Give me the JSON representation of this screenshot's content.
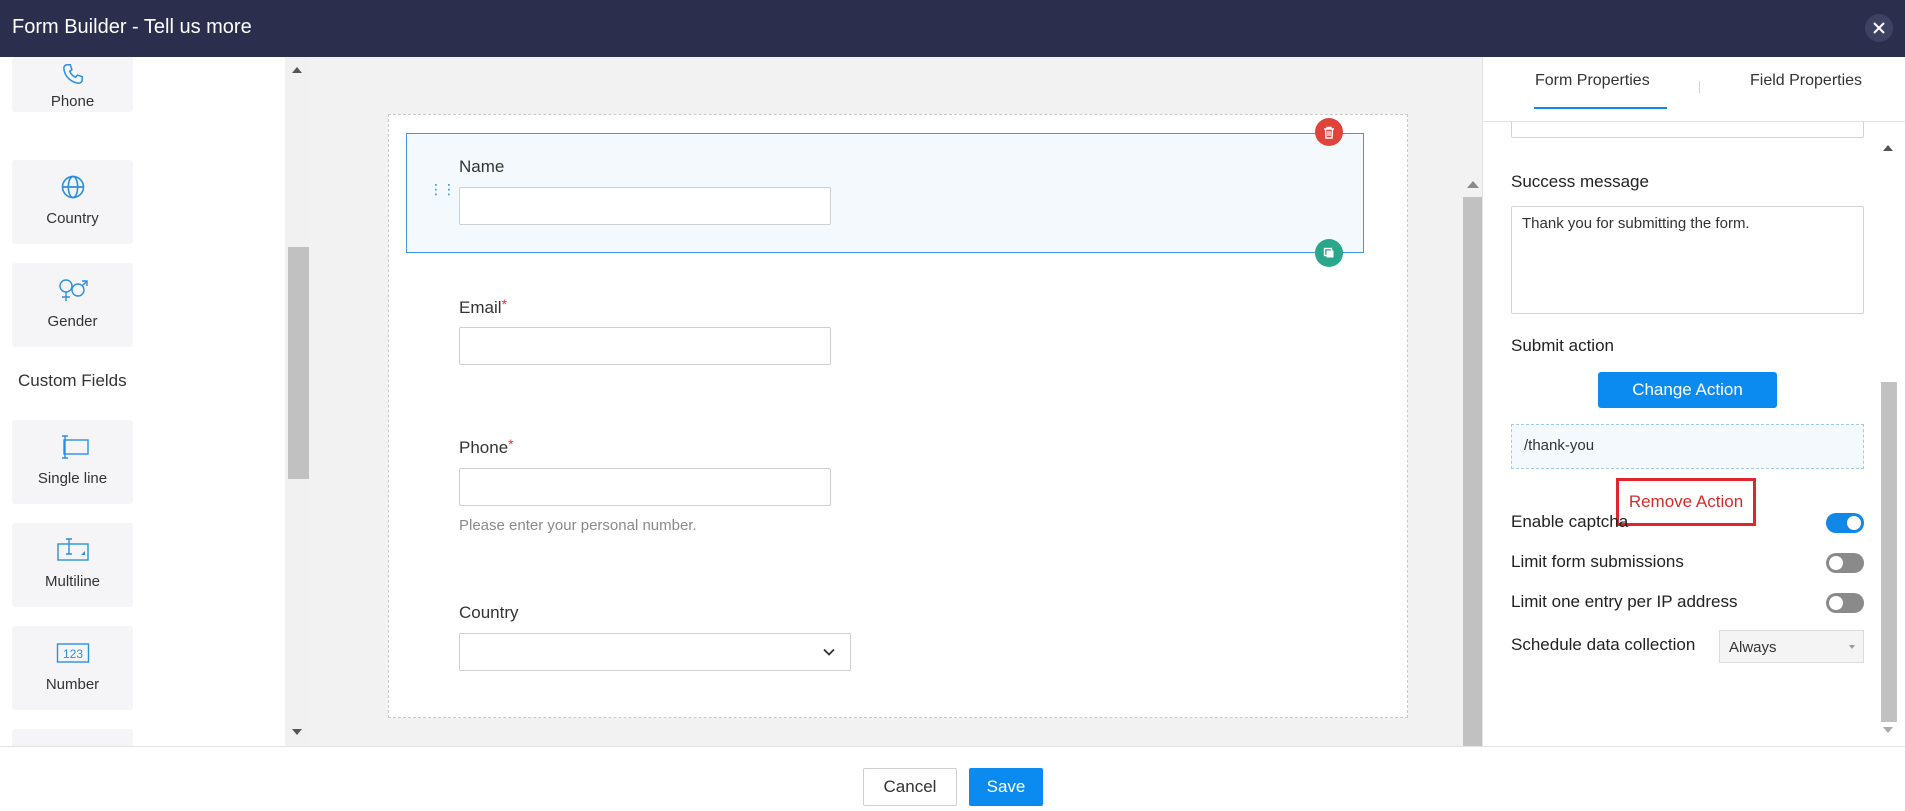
{
  "window": {
    "title": "Form Builder - Tell us more"
  },
  "palette": {
    "items_top": [
      {
        "label": "Phone",
        "icon": "phone-icon"
      },
      {
        "label": "Country",
        "icon": "globe-icon"
      },
      {
        "label": "Gender",
        "icon": "gender-icon"
      }
    ],
    "section_title": "Custom Fields",
    "items_custom": [
      {
        "label": "Single line",
        "icon": "single-line-icon"
      },
      {
        "label": "Multiline",
        "icon": "multiline-icon"
      },
      {
        "label": "Number",
        "icon": "number-icon"
      }
    ],
    "number_icon_text": "123"
  },
  "form": {
    "fields": [
      {
        "label": "Name",
        "required": false,
        "value": ""
      },
      {
        "label": "Email",
        "required": true,
        "value": ""
      },
      {
        "label": "Phone",
        "required": true,
        "value": "",
        "hint": "Please enter your personal number."
      },
      {
        "label": "Country",
        "required": false,
        "type": "select",
        "value": ""
      }
    ],
    "required_mark": "*"
  },
  "props": {
    "tabs": [
      {
        "label": "Form Properties",
        "active": true
      },
      {
        "label": "Field Properties",
        "active": false
      }
    ],
    "success_message_label": "Success message",
    "success_message_value": "Thank you for submitting the form.",
    "submit_action_label": "Submit action",
    "change_action_label": "Change Action",
    "action_url": "/thank-you",
    "remove_action_label": "Remove Action",
    "toggles": [
      {
        "label": "Enable captcha",
        "on": true
      },
      {
        "label": "Limit form submissions",
        "on": false
      },
      {
        "label": "Limit one entry per IP address",
        "on": false
      }
    ],
    "schedule_label": "Schedule data collection",
    "schedule_value": "Always"
  },
  "footer": {
    "cancel_label": "Cancel",
    "save_label": "Save"
  },
  "colors": {
    "titlebar": "#2b2f4d",
    "accent": "#0b8bf0",
    "danger": "#e0433a",
    "copy": "#2aa68a",
    "highlight": "#e0252c"
  }
}
